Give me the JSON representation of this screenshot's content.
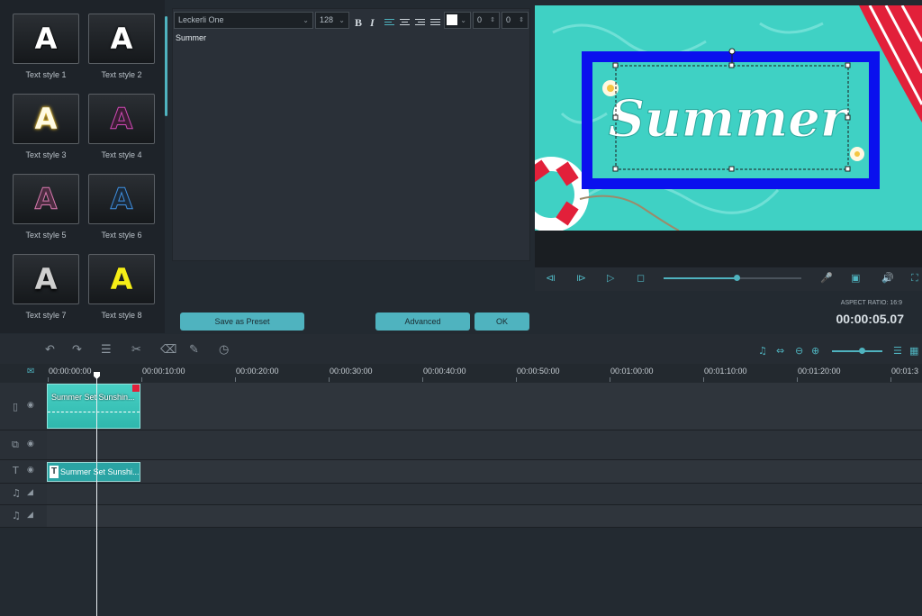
{
  "styles": [
    {
      "label": "Text style 1",
      "glyph": "A"
    },
    {
      "label": "Text style 2",
      "glyph": "A"
    },
    {
      "label": "Text style 3",
      "glyph": "A"
    },
    {
      "label": "Text style 4",
      "glyph": "A"
    },
    {
      "label": "Text style 5",
      "glyph": "A"
    },
    {
      "label": "Text style 6",
      "glyph": "A"
    },
    {
      "label": "Text style 7",
      "glyph": "A"
    },
    {
      "label": "Text style 8",
      "glyph": "A"
    }
  ],
  "editor": {
    "font": "Leckerli One",
    "size": "128",
    "bold": "B",
    "italic": "I",
    "spacing1": "0",
    "spacing2": "0",
    "text": "Summer"
  },
  "buttons": {
    "save_preset": "Save as Preset",
    "advanced": "Advanced",
    "ok": "OK"
  },
  "preview": {
    "title_text": "Summer",
    "aspect_ratio": "ASPECT RATIO: 16:9",
    "timecode": "00:00:05.07",
    "progress": 0.53
  },
  "timeline": {
    "ticks": [
      "00:00:00:00",
      "00:00:10:00",
      "00:00:20:00",
      "00:00:30:00",
      "00:00:40:00",
      "00:00:50:00",
      "00:01:00:00",
      "00:01:10:00",
      "00:01:20:00",
      "00:01:3"
    ],
    "video_clip": "Summer Set Sunshin...",
    "text_clip": "Summer Set Sunshi..."
  },
  "colors": {
    "accent": "#4fb3bf",
    "preview_bg": "#3fd1c4",
    "frame": "#0a10ee"
  }
}
